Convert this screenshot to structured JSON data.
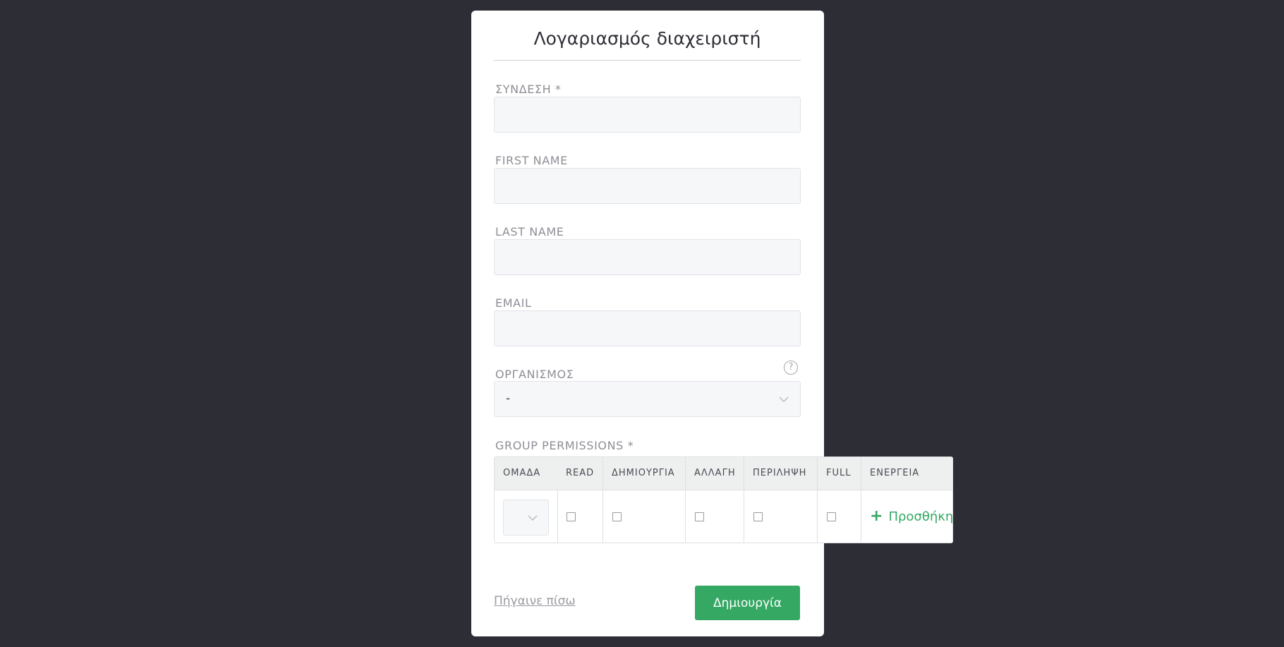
{
  "form": {
    "title": "Λογαριασμός διαχειριστή",
    "fields": {
      "login": {
        "label": "ΣΥΝΔΕΣΗ *",
        "value": ""
      },
      "first_name": {
        "label": "FIRST NAME",
        "value": ""
      },
      "last_name": {
        "label": "LAST NAME",
        "value": ""
      },
      "email": {
        "label": "EMAIL",
        "value": ""
      },
      "organization": {
        "label": "ΟΡΓΑΝΙΣΜΟΣ",
        "value": "-",
        "help_icon": "question-circle-icon"
      }
    },
    "group_permissions": {
      "label": "GROUP PERMISSIONS *",
      "columns": [
        "ΟΜΑΔΑ",
        "READ",
        "ΔΗΜΙΟΥΡΓΙΑ",
        "ΑΛΛΑΓΗ",
        "ΠΕΡΙΛΗΨΗ",
        "FULL",
        "ΕΝΕΡΓΕΙΑ"
      ],
      "row": {
        "group": "",
        "read": false,
        "create": false,
        "change": false,
        "summary": false,
        "full": false,
        "action_label": "Προσθήκη",
        "action_icon": "plus-icon"
      }
    },
    "back_label": "Πήγαινε πίσω",
    "submit_label": "Δημιουργία"
  },
  "colors": {
    "background": "#2d2d35",
    "accent": "#35a864"
  }
}
